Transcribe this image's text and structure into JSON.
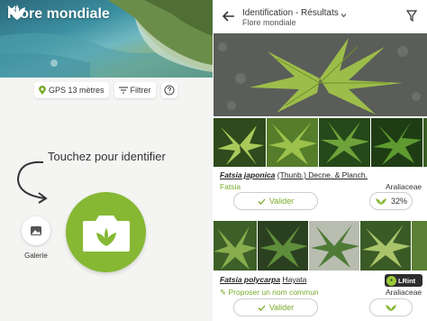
{
  "left": {
    "app_title": "Flore mondiale",
    "gps_label": "GPS 13 mètres",
    "filter_label": "Filtrer",
    "hint_text": "Touchez pour identifier",
    "gallery_label": "Galerie"
  },
  "right": {
    "title": "Identification - Résultats",
    "subtitle": "Flore mondiale",
    "results": [
      {
        "genus_species": "Fatsia japonica",
        "author": "(Thunb.) Decne. & Planch.",
        "common_name": "Fatsia",
        "family": "Araliaceae",
        "valider_label": "Valider",
        "score": "32%"
      },
      {
        "genus_species": "Fatsia polycarpa",
        "author": "Hayata",
        "common_name": "Proposer un nom commun",
        "family": "Araliaceae",
        "valider_label": "Valider",
        "badge": "LRint"
      }
    ]
  },
  "colors": {
    "accent_green": "#86b833",
    "text_green": "#7aab2a"
  }
}
